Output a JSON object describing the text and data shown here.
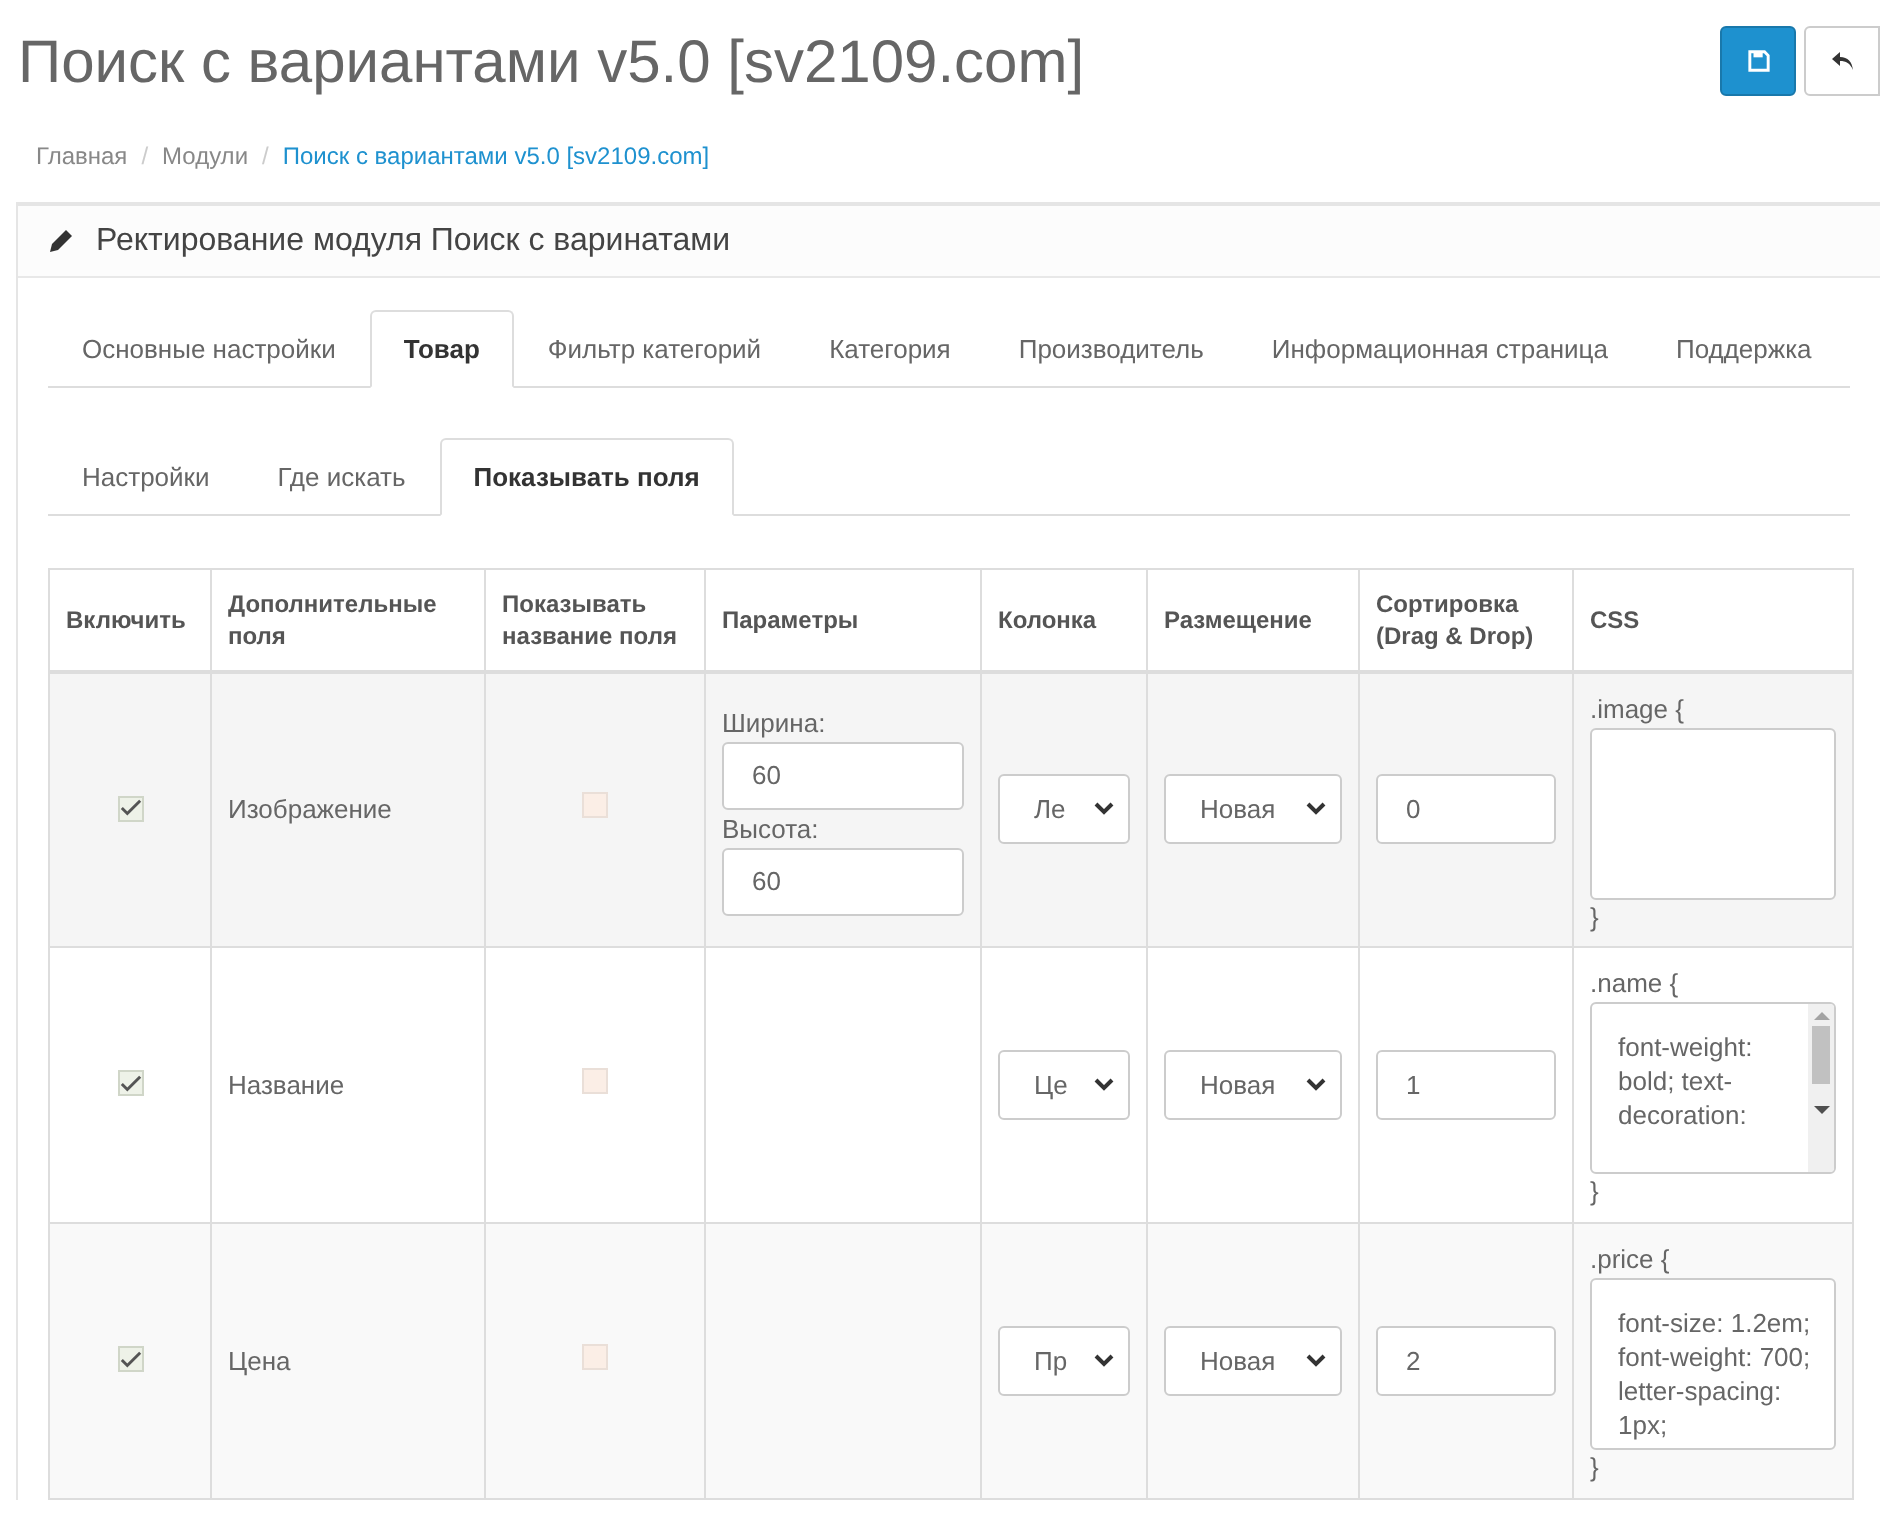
{
  "page_title": "Поиск с вариантами v5.0 [sv2109.com]",
  "breadcrumb_separator": "/",
  "breadcrumb": [
    {
      "label": "Главная",
      "current": false
    },
    {
      "label": "Модули",
      "current": false
    },
    {
      "label": "Поиск с вариантами v5.0 [sv2109.com]",
      "current": true
    }
  ],
  "panel_title": "Ректирование модуля Поиск с варинатами",
  "tabs": [
    {
      "label": "Основные настройки",
      "selected": false
    },
    {
      "label": "Товар",
      "selected": true
    },
    {
      "label": "Фильтр категорий",
      "selected": false
    },
    {
      "label": "Категория",
      "selected": false
    },
    {
      "label": "Производитель",
      "selected": false
    },
    {
      "label": "Информационная страница",
      "selected": false
    },
    {
      "label": "Поддержка",
      "selected": false
    }
  ],
  "subtabs": [
    {
      "label": "Настройки",
      "selected": false
    },
    {
      "label": "Где искать",
      "selected": false
    },
    {
      "label": "Показывать поля",
      "selected": true
    }
  ],
  "table": {
    "columns": [
      "Включить",
      "Дополнительные поля",
      "Показывать название поля",
      "Параметры",
      "Колонка",
      "Размещение",
      "Сортировка (Drag & Drop)",
      "CSS"
    ],
    "rows": [
      {
        "enabled": true,
        "field": "Изображение",
        "show_name": false,
        "highlighted": true,
        "params": [
          {
            "label": "Ширина:",
            "value": "60"
          },
          {
            "label": "Высота:",
            "value": "60"
          }
        ],
        "column": "Ле",
        "placement": "Новая",
        "sort": "0",
        "css_open": ".image {",
        "css_body": "",
        "css_scroll": false,
        "css_close": "}"
      },
      {
        "enabled": true,
        "field": "Название",
        "show_name": false,
        "highlighted": false,
        "column": "Це",
        "placement": "Новая",
        "sort": "1",
        "css_open": ".name {",
        "css_body": "font-weight: bold; text-decoration:",
        "css_scroll": true,
        "css_close": "}"
      },
      {
        "enabled": true,
        "field": "Цена",
        "show_name": false,
        "highlighted": false,
        "column": "Пр",
        "placement": "Новая",
        "sort": "2",
        "css_open": ".price {",
        "css_body": "font-size: 1.2em; font-weight: 700; letter-spacing: 1px;",
        "css_scroll": false,
        "css_close": "}"
      }
    ]
  }
}
